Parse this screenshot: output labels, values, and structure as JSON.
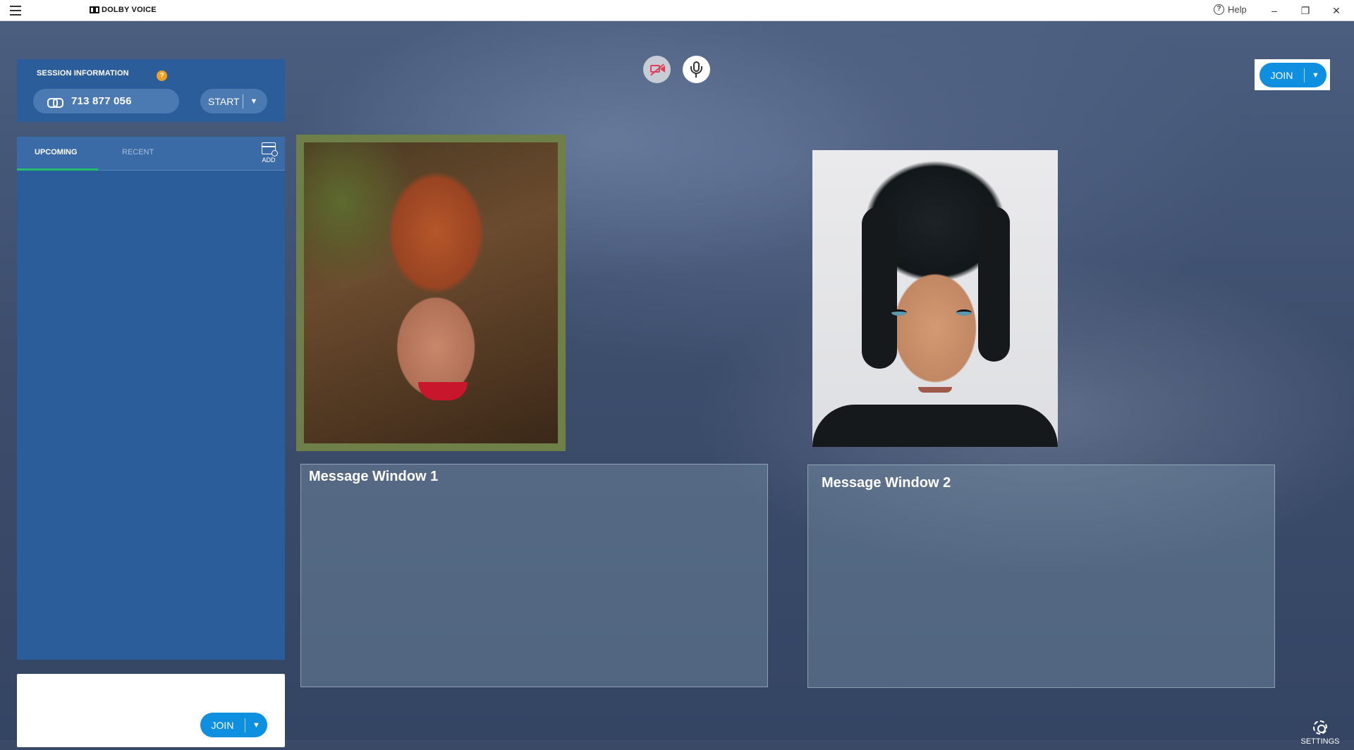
{
  "app": {
    "brand": "DOLBY VOICE",
    "help_label": "Help",
    "window_controls": {
      "minimize": "–",
      "restore": "❐",
      "close": "✕"
    }
  },
  "session": {
    "title": "SESSION INFORMATION",
    "help_badge": "?",
    "meeting_id": "713 877 056",
    "start_label": "START"
  },
  "tabs": {
    "upcoming": "UPCOMING",
    "recent": "RECENT",
    "add_label": "ADD",
    "active": "UPCOMING"
  },
  "join": {
    "label": "JOIN",
    "chevron": "⌄"
  },
  "media": {
    "camera_state": "muted",
    "mic_state": "on",
    "camera_icon_color": "#e0405a"
  },
  "messages": [
    {
      "title": "Message Window 1"
    },
    {
      "title": "Message Window 2"
    }
  ],
  "settings": {
    "label": "SETTINGS"
  },
  "colors": {
    "panel_blue": "#2c5d9b",
    "join_blue": "#0e8fe0",
    "tab_active_underline": "#22c06a",
    "help_badge": "#f0a020",
    "active_speaker_border": "#6e8048"
  }
}
